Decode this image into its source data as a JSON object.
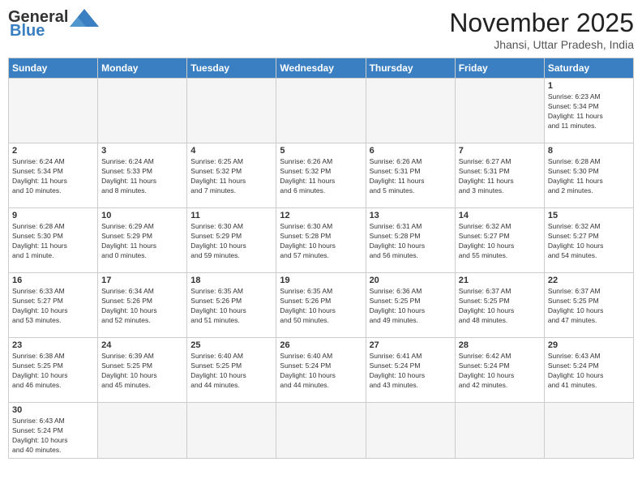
{
  "header": {
    "logo_general": "General",
    "logo_blue": "Blue",
    "month_title": "November 2025",
    "location": "Jhansi, Uttar Pradesh, India"
  },
  "weekdays": [
    "Sunday",
    "Monday",
    "Tuesday",
    "Wednesday",
    "Thursday",
    "Friday",
    "Saturday"
  ],
  "weeks": [
    [
      {
        "day": "",
        "info": ""
      },
      {
        "day": "",
        "info": ""
      },
      {
        "day": "",
        "info": ""
      },
      {
        "day": "",
        "info": ""
      },
      {
        "day": "",
        "info": ""
      },
      {
        "day": "",
        "info": ""
      },
      {
        "day": "1",
        "info": "Sunrise: 6:23 AM\nSunset: 5:34 PM\nDaylight: 11 hours\nand 11 minutes."
      }
    ],
    [
      {
        "day": "2",
        "info": "Sunrise: 6:24 AM\nSunset: 5:34 PM\nDaylight: 11 hours\nand 10 minutes."
      },
      {
        "day": "3",
        "info": "Sunrise: 6:24 AM\nSunset: 5:33 PM\nDaylight: 11 hours\nand 8 minutes."
      },
      {
        "day": "4",
        "info": "Sunrise: 6:25 AM\nSunset: 5:32 PM\nDaylight: 11 hours\nand 7 minutes."
      },
      {
        "day": "5",
        "info": "Sunrise: 6:26 AM\nSunset: 5:32 PM\nDaylight: 11 hours\nand 6 minutes."
      },
      {
        "day": "6",
        "info": "Sunrise: 6:26 AM\nSunset: 5:31 PM\nDaylight: 11 hours\nand 5 minutes."
      },
      {
        "day": "7",
        "info": "Sunrise: 6:27 AM\nSunset: 5:31 PM\nDaylight: 11 hours\nand 3 minutes."
      },
      {
        "day": "8",
        "info": "Sunrise: 6:28 AM\nSunset: 5:30 PM\nDaylight: 11 hours\nand 2 minutes."
      }
    ],
    [
      {
        "day": "9",
        "info": "Sunrise: 6:28 AM\nSunset: 5:30 PM\nDaylight: 11 hours\nand 1 minute."
      },
      {
        "day": "10",
        "info": "Sunrise: 6:29 AM\nSunset: 5:29 PM\nDaylight: 11 hours\nand 0 minutes."
      },
      {
        "day": "11",
        "info": "Sunrise: 6:30 AM\nSunset: 5:29 PM\nDaylight: 10 hours\nand 59 minutes."
      },
      {
        "day": "12",
        "info": "Sunrise: 6:30 AM\nSunset: 5:28 PM\nDaylight: 10 hours\nand 57 minutes."
      },
      {
        "day": "13",
        "info": "Sunrise: 6:31 AM\nSunset: 5:28 PM\nDaylight: 10 hours\nand 56 minutes."
      },
      {
        "day": "14",
        "info": "Sunrise: 6:32 AM\nSunset: 5:27 PM\nDaylight: 10 hours\nand 55 minutes."
      },
      {
        "day": "15",
        "info": "Sunrise: 6:32 AM\nSunset: 5:27 PM\nDaylight: 10 hours\nand 54 minutes."
      }
    ],
    [
      {
        "day": "16",
        "info": "Sunrise: 6:33 AM\nSunset: 5:27 PM\nDaylight: 10 hours\nand 53 minutes."
      },
      {
        "day": "17",
        "info": "Sunrise: 6:34 AM\nSunset: 5:26 PM\nDaylight: 10 hours\nand 52 minutes."
      },
      {
        "day": "18",
        "info": "Sunrise: 6:35 AM\nSunset: 5:26 PM\nDaylight: 10 hours\nand 51 minutes."
      },
      {
        "day": "19",
        "info": "Sunrise: 6:35 AM\nSunset: 5:26 PM\nDaylight: 10 hours\nand 50 minutes."
      },
      {
        "day": "20",
        "info": "Sunrise: 6:36 AM\nSunset: 5:25 PM\nDaylight: 10 hours\nand 49 minutes."
      },
      {
        "day": "21",
        "info": "Sunrise: 6:37 AM\nSunset: 5:25 PM\nDaylight: 10 hours\nand 48 minutes."
      },
      {
        "day": "22",
        "info": "Sunrise: 6:37 AM\nSunset: 5:25 PM\nDaylight: 10 hours\nand 47 minutes."
      }
    ],
    [
      {
        "day": "23",
        "info": "Sunrise: 6:38 AM\nSunset: 5:25 PM\nDaylight: 10 hours\nand 46 minutes."
      },
      {
        "day": "24",
        "info": "Sunrise: 6:39 AM\nSunset: 5:25 PM\nDaylight: 10 hours\nand 45 minutes."
      },
      {
        "day": "25",
        "info": "Sunrise: 6:40 AM\nSunset: 5:25 PM\nDaylight: 10 hours\nand 44 minutes."
      },
      {
        "day": "26",
        "info": "Sunrise: 6:40 AM\nSunset: 5:24 PM\nDaylight: 10 hours\nand 44 minutes."
      },
      {
        "day": "27",
        "info": "Sunrise: 6:41 AM\nSunset: 5:24 PM\nDaylight: 10 hours\nand 43 minutes."
      },
      {
        "day": "28",
        "info": "Sunrise: 6:42 AM\nSunset: 5:24 PM\nDaylight: 10 hours\nand 42 minutes."
      },
      {
        "day": "29",
        "info": "Sunrise: 6:43 AM\nSunset: 5:24 PM\nDaylight: 10 hours\nand 41 minutes."
      }
    ],
    [
      {
        "day": "30",
        "info": "Sunrise: 6:43 AM\nSunset: 5:24 PM\nDaylight: 10 hours\nand 40 minutes."
      },
      {
        "day": "",
        "info": ""
      },
      {
        "day": "",
        "info": ""
      },
      {
        "day": "",
        "info": ""
      },
      {
        "day": "",
        "info": ""
      },
      {
        "day": "",
        "info": ""
      },
      {
        "day": "",
        "info": ""
      }
    ]
  ]
}
